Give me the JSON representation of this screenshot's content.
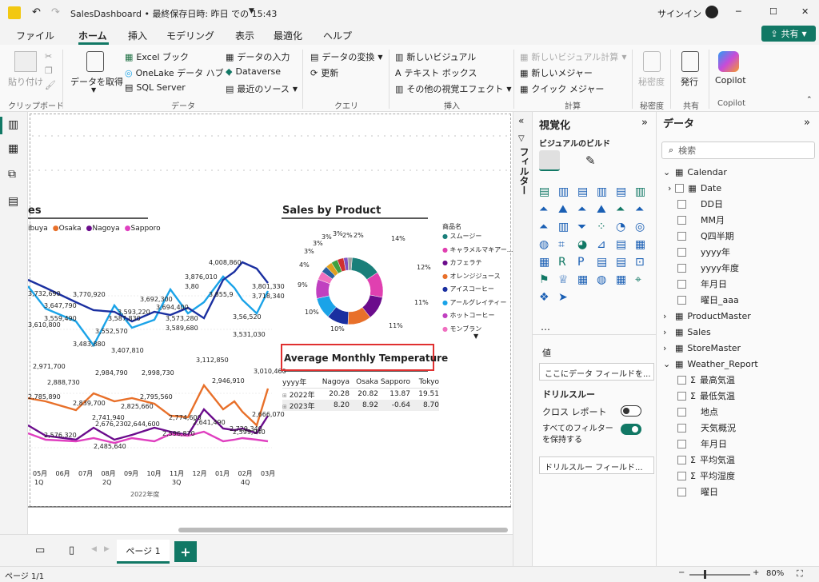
{
  "titlebar": {
    "title": "SalesDashboard • 最終保存日時: 昨日 での 15:43",
    "signin": "サインイン",
    "min": "─",
    "max": "☐",
    "close": "✕"
  },
  "menu": {
    "tabs": [
      "ファイル",
      "ホーム",
      "挿入",
      "モデリング",
      "表示",
      "最適化",
      "ヘルプ"
    ],
    "share": "共有"
  },
  "ribbon": {
    "paste": "貼り付け",
    "clipboard_group": "クリップボード",
    "get_data": "データを取得",
    "excel": "Excel ブック",
    "onelake": "OneLake データ ハブ",
    "sql": "SQL Server",
    "enter_data": "データの入力",
    "dataverse": "Dataverse",
    "recent_sources": "最近のソース",
    "data_group": "データ",
    "transform": "データの変換",
    "refresh": "更新",
    "query_group": "クエリ",
    "new_visual": "新しいビジュアル",
    "textbox": "テキスト ボックス",
    "more_visuals": "その他の視覚エフェクト",
    "insert_group": "挿入",
    "new_calc": "新しいビジュアル計算",
    "new_measure": "新しいメジャー",
    "quick_measure": "クイック メジャー",
    "calc_group": "計算",
    "sensitivity": "秘密度",
    "sensitivity_group": "秘密度",
    "publish": "発行",
    "share_group": "共有",
    "copilot": "Copilot",
    "copilot_group": "Copilot"
  },
  "canvas": {
    "line_chart_title": "es",
    "legend": [
      {
        "name": "ibuya",
        "color": "#1aa3e8"
      },
      {
        "name": "Osaka",
        "color": "#e8702a"
      },
      {
        "name": "Nagoya",
        "color": "#6b0c8c"
      },
      {
        "name": "Sapporo",
        "color": "#e040c0"
      }
    ],
    "top_labels": [
      "3,732,690",
      "3,647,790",
      "3,770,920",
      "3,559,490",
      "3,610,800",
      "3,483,880",
      "3,552,570",
      "3,593,220",
      "3,587,830",
      "3,407,810",
      "3,692,300",
      "3,694,400",
      "3,573,280",
      "3,589,680",
      "3,876,010",
      "3,80",
      "3,855,9",
      "4,008,860",
      "3,801,330",
      "3,718,340",
      "3,56,520",
      "3,531,030"
    ],
    "bottom_labels": [
      "2,971,700",
      "2,888,730",
      "2,785,890",
      "2,984,790",
      "2,998,730",
      "2,839,700",
      "2,825,660",
      "2,795,560",
      "3,112,850",
      "2,946,910",
      "3,010,460",
      "2,741,940",
      "2,676,230",
      "2,644,600",
      "2,774,600",
      "2,641,490",
      "2,666,070",
      "2,576,320",
      "2,485,640",
      "2,596,870",
      "2,729,340",
      "2,599,940"
    ],
    "x_months": [
      "05月",
      "06月",
      "07月",
      "08月",
      "09月",
      "10月",
      "11月",
      "12月",
      "01月",
      "02月",
      "03月"
    ],
    "x_quarters": [
      "1Q",
      "2Q",
      "3Q",
      "4Q"
    ],
    "x_year": "2022年度",
    "donut_title": "Sales by Product",
    "donut_legend_title": "商品名",
    "donut_items": [
      {
        "name": "スムージー",
        "pct": 14,
        "color": "#1a7f7a"
      },
      {
        "name": "キャラメルマキアー...",
        "pct": 12,
        "color": "#e040b0"
      },
      {
        "name": "カフェラテ",
        "pct": 11,
        "color": "#6b0c8c"
      },
      {
        "name": "オレンジジュース",
        "pct": 11,
        "color": "#e8702a"
      },
      {
        "name": "アイスコーヒー",
        "pct": 10,
        "color": "#1a2fa0"
      },
      {
        "name": "アールグレイティー",
        "pct": 10,
        "color": "#1aa3e8"
      },
      {
        "name": "ホットコーヒー",
        "pct": 9,
        "color": "#c040c0"
      },
      {
        "name": "モンブラン",
        "pct": 4,
        "color": "#f070c0"
      },
      {
        "name": "",
        "pct": 3,
        "color": "#2a60a0"
      },
      {
        "name": "",
        "pct": 3,
        "color": "#e0a020"
      },
      {
        "name": "",
        "pct": 3,
        "color": "#40a040"
      },
      {
        "name": "",
        "pct": 3,
        "color": "#d03030"
      },
      {
        "name": "",
        "pct": 2,
        "color": "#8050c0"
      },
      {
        "name": "",
        "pct": 2,
        "color": "#a0a0a0"
      }
    ],
    "donut_labels": [
      "14%",
      "12%",
      "11%",
      "11%",
      "10%",
      "10%",
      "9%",
      "4%",
      "3%",
      "3%",
      "3%",
      "3%",
      "2%",
      "2%"
    ],
    "table_title": "Average Monthly Temperature",
    "table_headers": [
      "yyyy年",
      "Nagoya",
      "Osaka",
      "Sapporo",
      "Tokyo"
    ],
    "table_rows": [
      [
        "2022年",
        "20.28",
        "20.82",
        "13.87",
        "19.51"
      ],
      [
        "2023年",
        "8.20",
        "8.92",
        "-0.64",
        "8.70"
      ]
    ]
  },
  "bottombar": {
    "page": "ページ 1",
    "add": "+"
  },
  "status": {
    "page": "ページ 1/1",
    "zoom": "80%"
  },
  "filters_label": "フィルター",
  "viz": {
    "title": "視覚化",
    "build": "ビジュアルのビルド",
    "values": "値",
    "values_placeholder": "ここにデータ フィールドを...",
    "drill": "ドリルスルー",
    "cross_report": "クロス レポート",
    "cross_report_state": "オフ",
    "keep_filters": "すべてのフィルターを保持する",
    "keep_filters_state": "オン",
    "drill_placeholder": "ドリルスルー フィールド..."
  },
  "data": {
    "title": "データ",
    "search_placeholder": "検索",
    "tree": [
      {
        "label": "Calendar",
        "level": 0,
        "type": "table",
        "expanded": true
      },
      {
        "label": "Date",
        "level": 1,
        "type": "hier"
      },
      {
        "label": "DD日",
        "level": 1,
        "type": "field"
      },
      {
        "label": "MM月",
        "level": 1,
        "type": "field"
      },
      {
        "label": "Q四半期",
        "level": 1,
        "type": "field"
      },
      {
        "label": "yyyy年",
        "level": 1,
        "type": "field"
      },
      {
        "label": "yyyy年度",
        "level": 1,
        "type": "field"
      },
      {
        "label": "年月日",
        "level": 1,
        "type": "field"
      },
      {
        "label": "曜日_aaa",
        "level": 1,
        "type": "field"
      },
      {
        "label": "ProductMaster",
        "level": 0,
        "type": "table",
        "expanded": false
      },
      {
        "label": "Sales",
        "level": 0,
        "type": "table",
        "expanded": false
      },
      {
        "label": "StoreMaster",
        "level": 0,
        "type": "table",
        "expanded": false
      },
      {
        "label": "Weather_Report",
        "level": 0,
        "type": "table",
        "expanded": true
      },
      {
        "label": "最高気温",
        "level": 1,
        "type": "sum"
      },
      {
        "label": "最低気温",
        "level": 1,
        "type": "sum"
      },
      {
        "label": "地点",
        "level": 1,
        "type": "field"
      },
      {
        "label": "天気概況",
        "level": 1,
        "type": "field"
      },
      {
        "label": "年月日",
        "level": 1,
        "type": "field"
      },
      {
        "label": "平均気温",
        "level": 1,
        "type": "sum"
      },
      {
        "label": "平均湿度",
        "level": 1,
        "type": "sum"
      },
      {
        "label": "曜日",
        "level": 1,
        "type": "field"
      }
    ]
  },
  "colors": {
    "accent": "#117865",
    "highlight": "#e03030"
  }
}
